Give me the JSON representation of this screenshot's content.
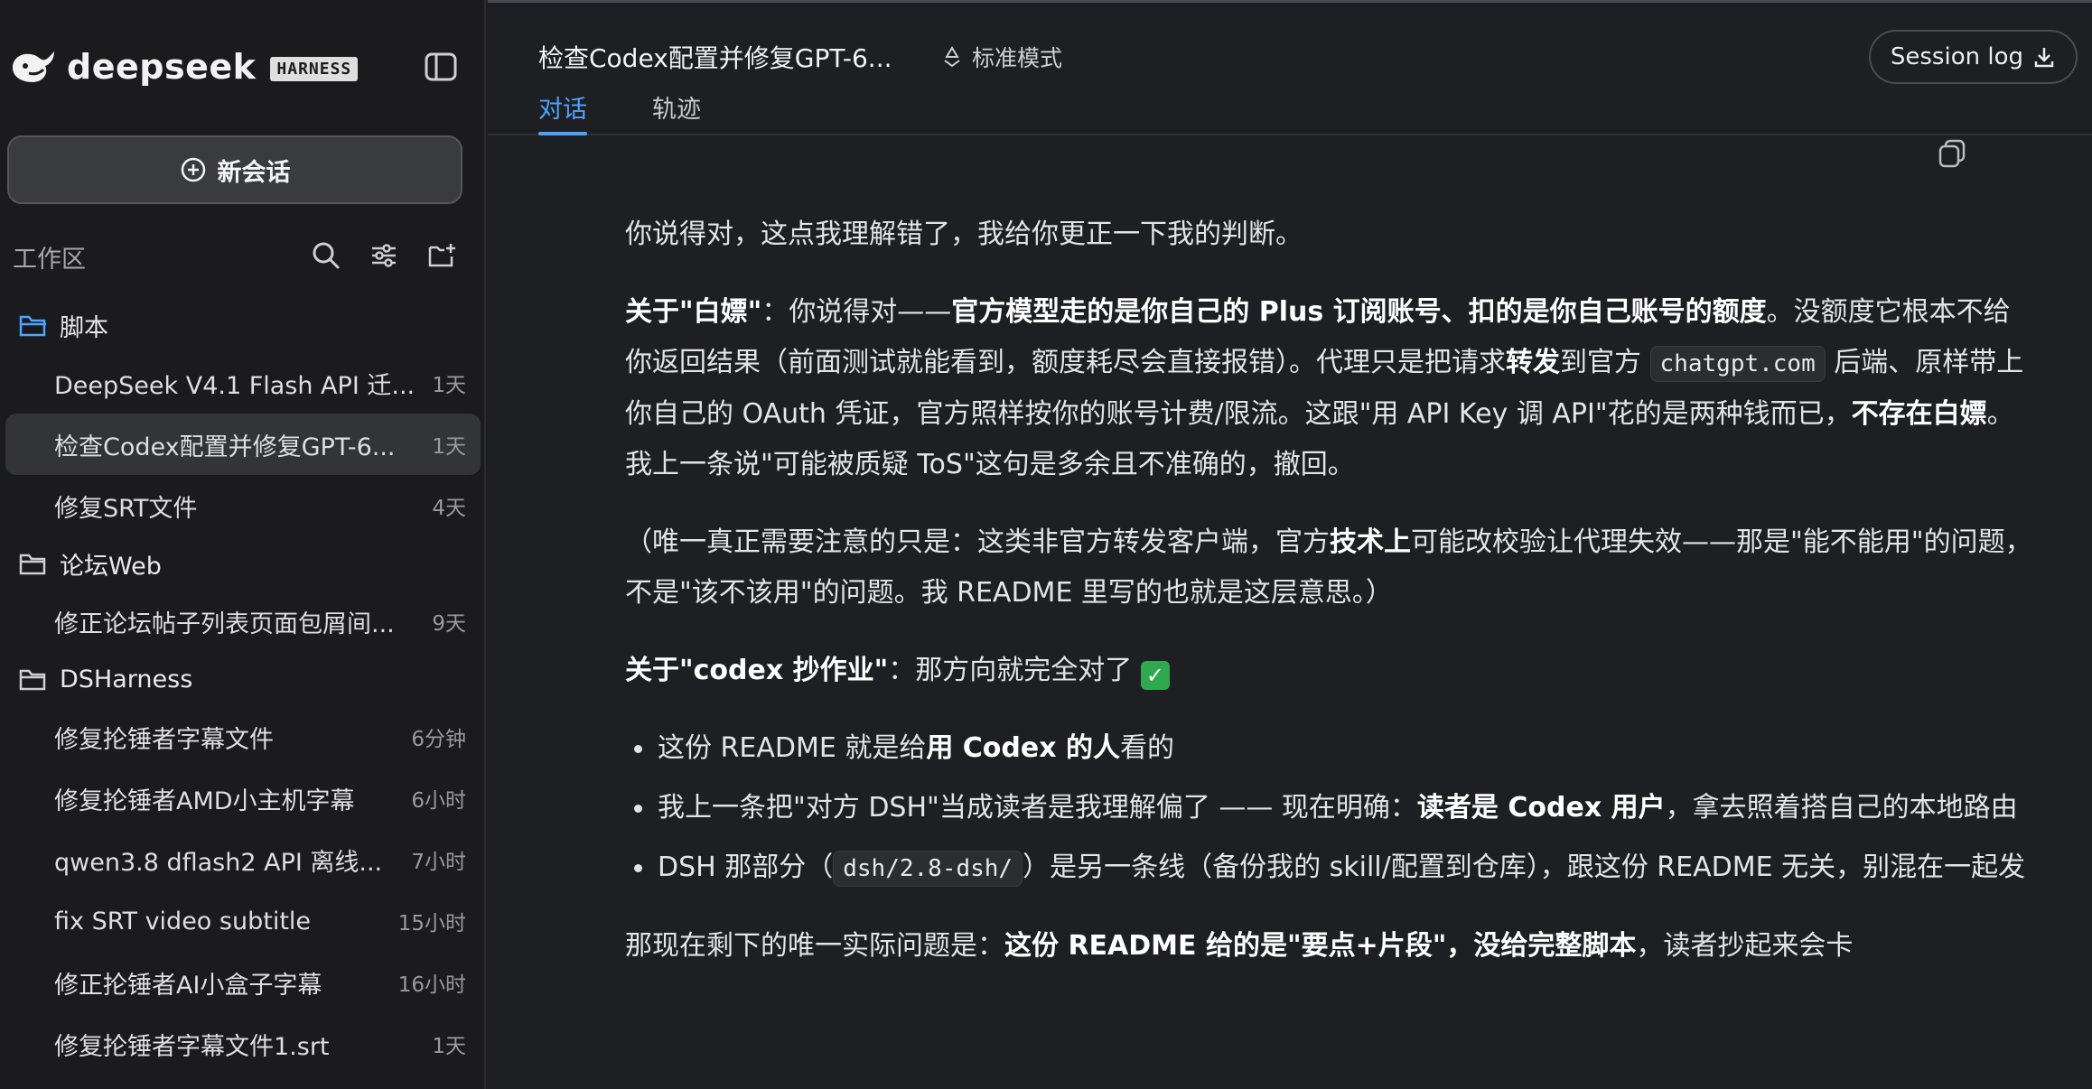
{
  "brand": {
    "name": "deepseek",
    "badge": "HARNESS"
  },
  "sidebar": {
    "new_chat_label": "新会话",
    "workspace_label": "工作区",
    "groups": [
      {
        "name": "脚本",
        "items": [
          {
            "title": "DeepSeek V4.1 Flash API 迁...",
            "time": "1天"
          },
          {
            "title": "检查Codex配置并修复GPT-6...",
            "time": "1天",
            "active": true
          },
          {
            "title": "修复SRT文件",
            "time": "4天"
          }
        ]
      },
      {
        "name": "论坛Web",
        "items": [
          {
            "title": "修正论坛帖子列表页面包屑间...",
            "time": "9天"
          }
        ]
      },
      {
        "name": "DSHarness",
        "items": [
          {
            "title": "修复抡锤者字幕文件",
            "time": "6分钟"
          },
          {
            "title": "修复抡锤者AMD小主机字幕",
            "time": "6小时"
          },
          {
            "title": "qwen3.8 dflash2 API 离线...",
            "time": "7小时"
          },
          {
            "title": "fix SRT video subtitle",
            "time": "15小时"
          },
          {
            "title": "修正抡锤者AI小盒子字幕",
            "time": "16小时"
          },
          {
            "title": "修复抡锤者字幕文件1.srt",
            "time": "1天"
          }
        ]
      }
    ]
  },
  "header": {
    "title": "检查Codex配置并修复GPT-6...",
    "mode": "标准模式",
    "session_log": "Session log",
    "tabs": [
      "对话",
      "轨迹"
    ]
  },
  "message": {
    "p1": "你说得对，这点我理解错了，我给你更正一下我的判断。",
    "p2_a": "关于\"白嫖\"",
    "p2_b": "：你说得对——",
    "p2_c": "官方模型走的是你自己的 Plus 订阅账号、扣的是你自己账号的额度",
    "p2_d": "。没额度它根本不给你返回结果（前面测试就能看到，额度耗尽会直接报错）。代理只是把请求",
    "p2_e": "转发",
    "p2_f": "到官方 ",
    "p2_code": "chatgpt.com",
    "p2_g": " 后端、原样带上你自己的 OAuth 凭证，官方照样按你的账号计费/限流。这跟\"用 API Key 调 API\"花的是两种钱而已，",
    "p2_h": "不存在白嫖",
    "p2_i": "。我上一条说\"可能被质疑 ToS\"这句是多余且不准确的，撤回。",
    "p3_a": "（唯一真正需要注意的只是：这类非官方转发客户端，官方",
    "p3_b": "技术上",
    "p3_c": "可能改校验让代理失效——那是\"能不能用\"的问题，不是\"该不该用\"的问题。我 README 里写的也就是这层意思。）",
    "p4_a": "关于\"codex 抄作业\"",
    "p4_b": "：那方向就完全对了 ",
    "p4_check": "✓",
    "li1_a": "这份 README 就是给",
    "li1_b": "用 Codex 的人",
    "li1_c": "看的",
    "li2_a": "我上一条把\"对方 DSH\"当成读者是我理解偏了 —— 现在明确：",
    "li2_b": "读者是 Codex 用户",
    "li2_c": "，拿去照着搭自己的本地路由",
    "li3_a": "DSH 那部分（",
    "li3_code": "dsh/2.8-dsh/",
    "li3_b": "）是另一条线（备份我的 skill/配置到仓库），跟这份 README 无关，别混在一起发",
    "p5_a": "那现在剩下的唯一实际问题是：",
    "p5_b": "这份 README 给的是\"要点+片段\"，没给完整脚本",
    "p5_c": "，读者抄起来会卡"
  },
  "colors": {
    "accent": "#4ea3ff",
    "sidebar_bg": "#1b1b1d",
    "main_bg": "#1e1f22",
    "check": "#2fa84f"
  }
}
